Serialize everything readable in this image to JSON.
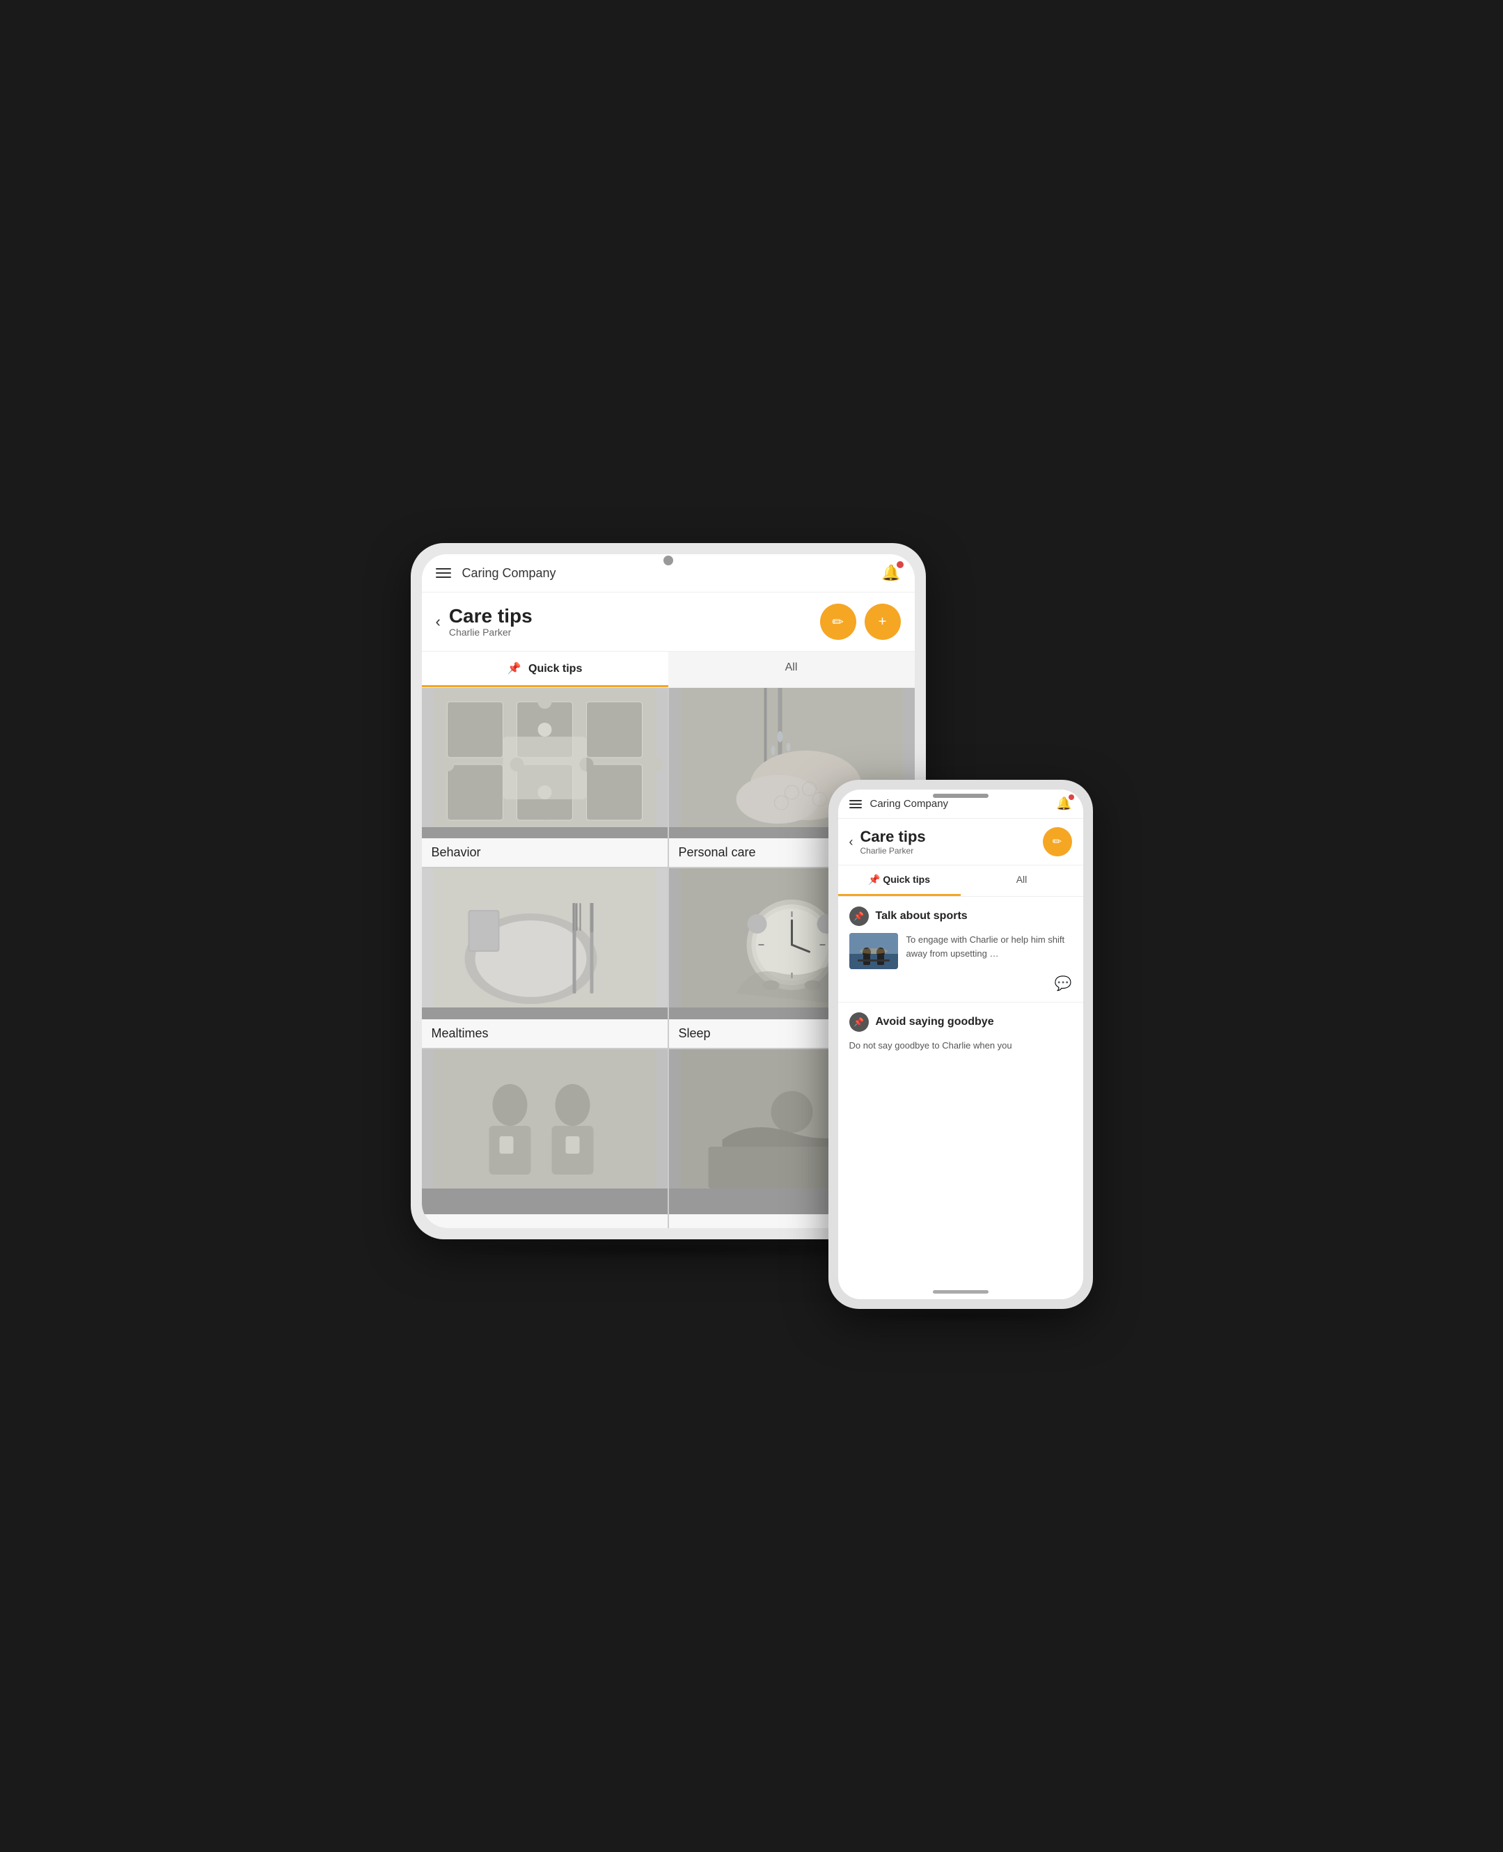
{
  "app": {
    "name": "Caring Company"
  },
  "tablet": {
    "header": {
      "title": "Caring Company"
    },
    "page": {
      "title": "Care tips",
      "subtitle": "Charlie Parker",
      "back_label": "‹"
    },
    "tabs": [
      {
        "id": "quick-tips",
        "label": "Quick tips",
        "active": true
      },
      {
        "id": "all",
        "label": "All",
        "active": false
      }
    ],
    "grid_items": [
      {
        "id": "behavior",
        "label": "Behavior"
      },
      {
        "id": "personal-care",
        "label": "Personal care"
      },
      {
        "id": "mealtimes",
        "label": "Mealtimes"
      },
      {
        "id": "sleep",
        "label": "Sleep"
      },
      {
        "id": "social",
        "label": ""
      },
      {
        "id": "activities",
        "label": ""
      }
    ],
    "buttons": {
      "edit_label": "✏",
      "add_label": "+"
    }
  },
  "phone": {
    "header": {
      "title": "Caring Company"
    },
    "page": {
      "title": "Care tips",
      "subtitle": "Charlie Parker"
    },
    "tabs": [
      {
        "id": "quick-tips",
        "label": "Quick tips",
        "active": true
      },
      {
        "id": "all",
        "label": "All",
        "active": false
      }
    ],
    "tips": [
      {
        "id": "talk-sports",
        "title": "Talk about sports",
        "description": "To engage with Charlie or help him shift away from upsetting …",
        "has_thumbnail": true,
        "has_comment": true
      },
      {
        "id": "avoid-goodbye",
        "title": "Avoid saying goodbye",
        "description": "Do not say goodbye to Charlie when you",
        "has_thumbnail": false,
        "has_comment": false
      }
    ],
    "buttons": {
      "edit_label": "✏"
    }
  }
}
